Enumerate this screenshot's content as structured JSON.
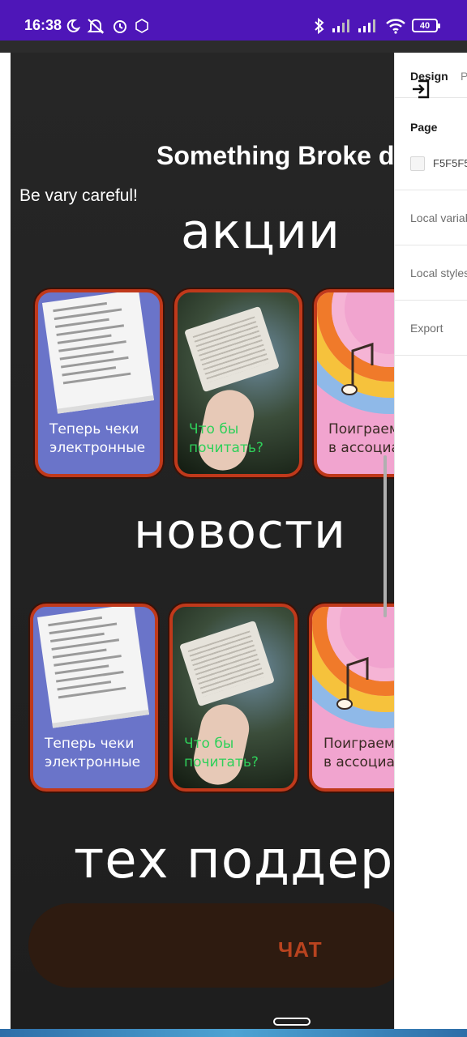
{
  "status_bar": {
    "time": "16:38",
    "battery": "40",
    "bg_color": "#4e16b8",
    "icons": [
      "moon-icon",
      "mute-icon",
      "alarm-icon",
      "hd-icon",
      "bluetooth-icon",
      "signal-icon",
      "signal-icon",
      "wifi-icon",
      "battery-icon"
    ]
  },
  "overlay": {
    "title": "Something Broke done",
    "subtitle": "Be vary careful!"
  },
  "sections": {
    "promotions_title": "акции",
    "news_title": "новости",
    "support_title": "тех поддержка"
  },
  "promo_cards": [
    {
      "caption_line1": "Теперь чеки",
      "caption_line2": "электронные",
      "image": "receipt-image"
    },
    {
      "caption_line1": "Что бы",
      "caption_line2": "почитать?",
      "image": "book-image"
    },
    {
      "caption_line1": "Поиграем",
      "caption_line2": "в ассоциации",
      "image": "music-image"
    }
  ],
  "news_cards": [
    {
      "caption_line1": "Теперь чеки",
      "caption_line2": "электронные",
      "image": "receipt-image"
    },
    {
      "caption_line1": "Что бы",
      "caption_line2": "почитать?",
      "image": "book-image"
    },
    {
      "caption_line1": "Поиграем",
      "caption_line2": "в ассоциации",
      "image": "music-image"
    }
  ],
  "chat_button": {
    "label": "ЧАТ"
  },
  "design_panel": {
    "tab_design": "Design",
    "tab_prototype": "P",
    "page_label": "Page",
    "page_color": "F5F5F5",
    "local_variables": "Local variables",
    "local_styles": "Local styles",
    "export": "Export"
  },
  "colors": {
    "card_border": "#c0391b",
    "caption_white": "#ffffff",
    "caption_green": "#2fd05a",
    "chat_text": "#b8431f",
    "frame_bg": "#232323"
  }
}
